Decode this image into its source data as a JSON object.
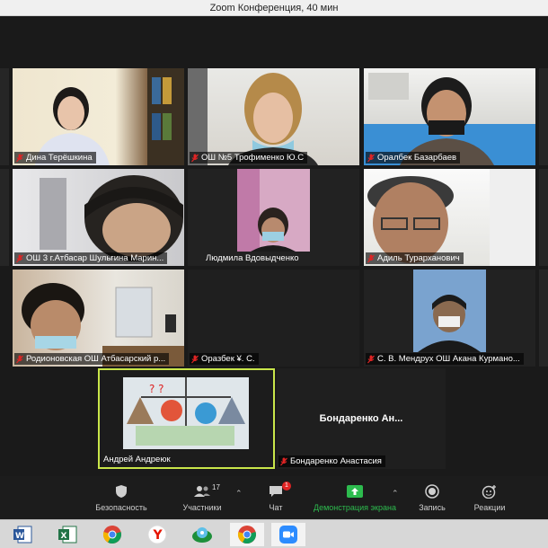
{
  "window": {
    "title": "Zoom Конференция, 40 мин"
  },
  "participants": [
    {
      "name": "Дина Терёшкина",
      "muted": true
    },
    {
      "name": "ОШ №5 Трофименко Ю.С",
      "muted": true
    },
    {
      "name": "Оралбек Базарбаев",
      "muted": true
    },
    {
      "name": "ОШ 3 г.Атбасар Шульгина Марин...",
      "muted": true
    },
    {
      "name": "Людмила Вдовыдченко",
      "muted": false
    },
    {
      "name": "Адиль Турарханович",
      "muted": true
    },
    {
      "name": "Родионовская ОШ Атбасарский р...",
      "muted": true
    },
    {
      "name": "Оразбек ¥. С.",
      "muted": true
    },
    {
      "name": "С. В. Мендрух ОШ Акана Курмано...",
      "muted": true
    },
    {
      "name": "Андрей Андреюк",
      "muted": false
    },
    {
      "name": "Бондаренко Анастасия",
      "muted": true,
      "display": "Бондаренко  Ан..."
    }
  ],
  "toolbar": {
    "security": "Безопасность",
    "participants": "Участники",
    "participants_count": "17",
    "chat": "Чат",
    "chat_badge": "1",
    "share": "Демонстрация экрана",
    "record": "Запись",
    "reactions": "Реакции"
  },
  "colors": {
    "active_speaker": "#c9e64a",
    "share_green": "#2dbb4e",
    "muted_red": "#e02424"
  },
  "taskbar": [
    "word-icon",
    "excel-icon",
    "chrome-icon",
    "yandex-icon",
    "daemon-tools-icon",
    "chrome-icon",
    "zoom-icon"
  ]
}
